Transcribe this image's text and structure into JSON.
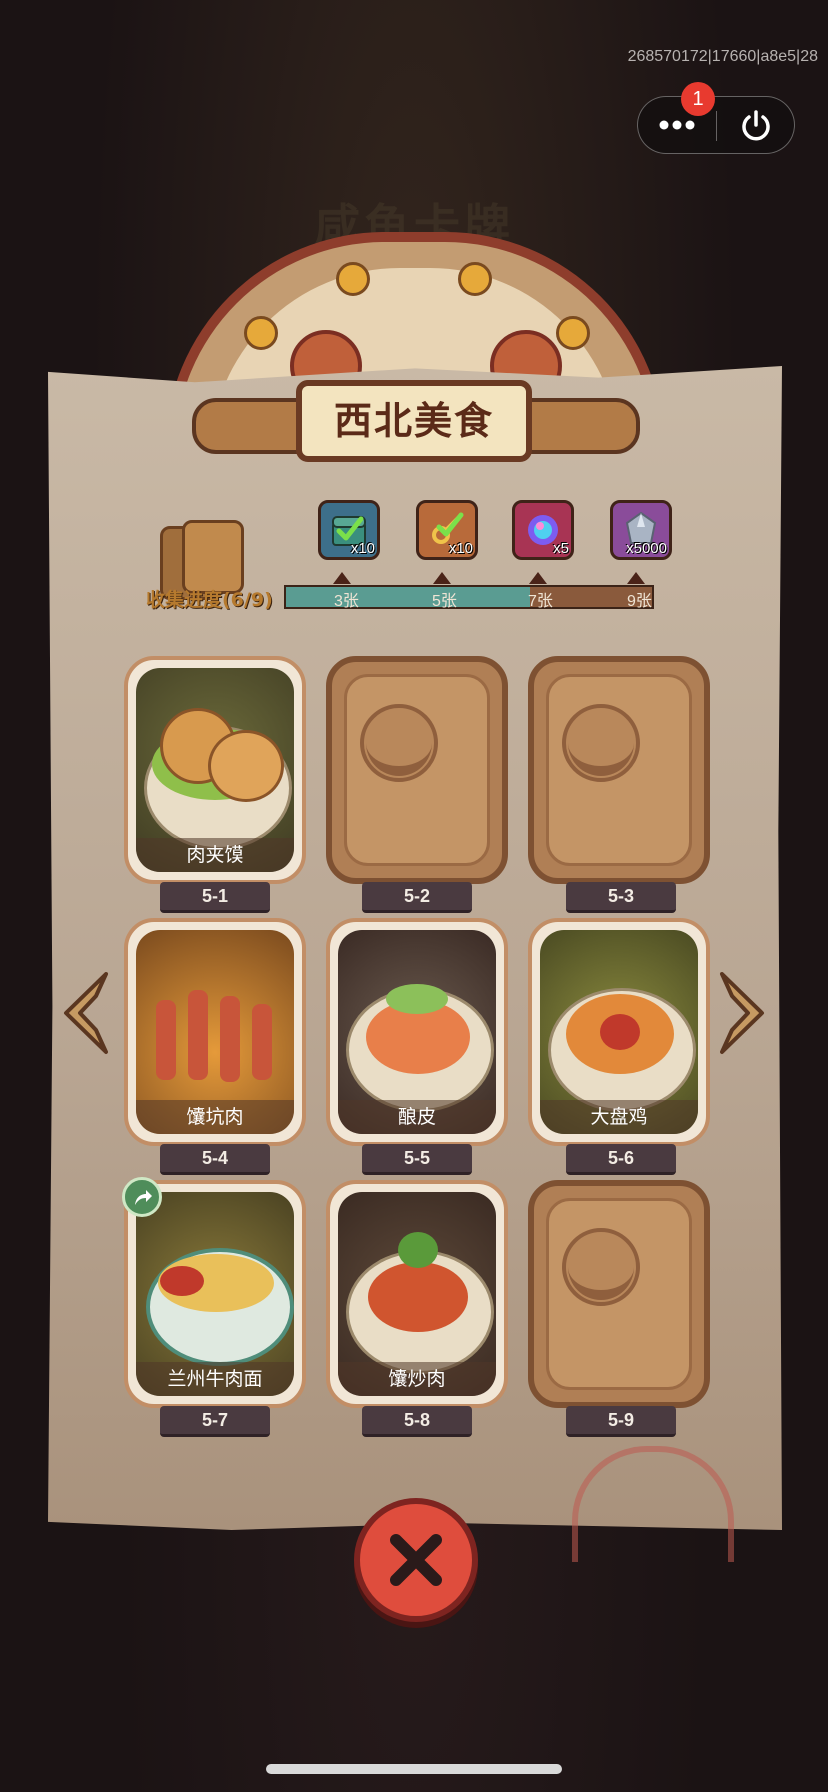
{
  "debug_id": "268570172|17660|a8e5|28",
  "menu": {
    "badge_count": "1"
  },
  "background_title": "咸鱼卡牌",
  "banner_title": "西北美食",
  "progress": {
    "label": "收集进度(6/9)",
    "collected": 6,
    "total": 9,
    "milestones": [
      {
        "label": "3张",
        "reward_icon": "treasure-chest-check-icon",
        "reward_qty": "x10"
      },
      {
        "label": "5张",
        "reward_icon": "golden-key-check-icon",
        "reward_qty": "x10"
      },
      {
        "label": "7张",
        "reward_icon": "magic-orb-icon",
        "reward_qty": "x5"
      },
      {
        "label": "9张",
        "reward_icon": "crystal-gem-icon",
        "reward_qty": "x5000"
      }
    ]
  },
  "cards": [
    {
      "level": "5-1",
      "name": "肉夹馍",
      "unlocked": true
    },
    {
      "level": "5-2",
      "name": "",
      "unlocked": false
    },
    {
      "level": "5-3",
      "name": "",
      "unlocked": false
    },
    {
      "level": "5-4",
      "name": "馕坑肉",
      "unlocked": true
    },
    {
      "level": "5-5",
      "name": "酿皮",
      "unlocked": true
    },
    {
      "level": "5-6",
      "name": "大盘鸡",
      "unlocked": true
    },
    {
      "level": "5-7",
      "name": "兰州牛肉面",
      "unlocked": true
    },
    {
      "level": "5-8",
      "name": "馕炒肉",
      "unlocked": true
    },
    {
      "level": "5-9",
      "name": "",
      "unlocked": false
    }
  ],
  "colors": {
    "progress_fill": "#5a9c92",
    "close_button": "#df4d3d",
    "badge": "#e83a2f"
  }
}
